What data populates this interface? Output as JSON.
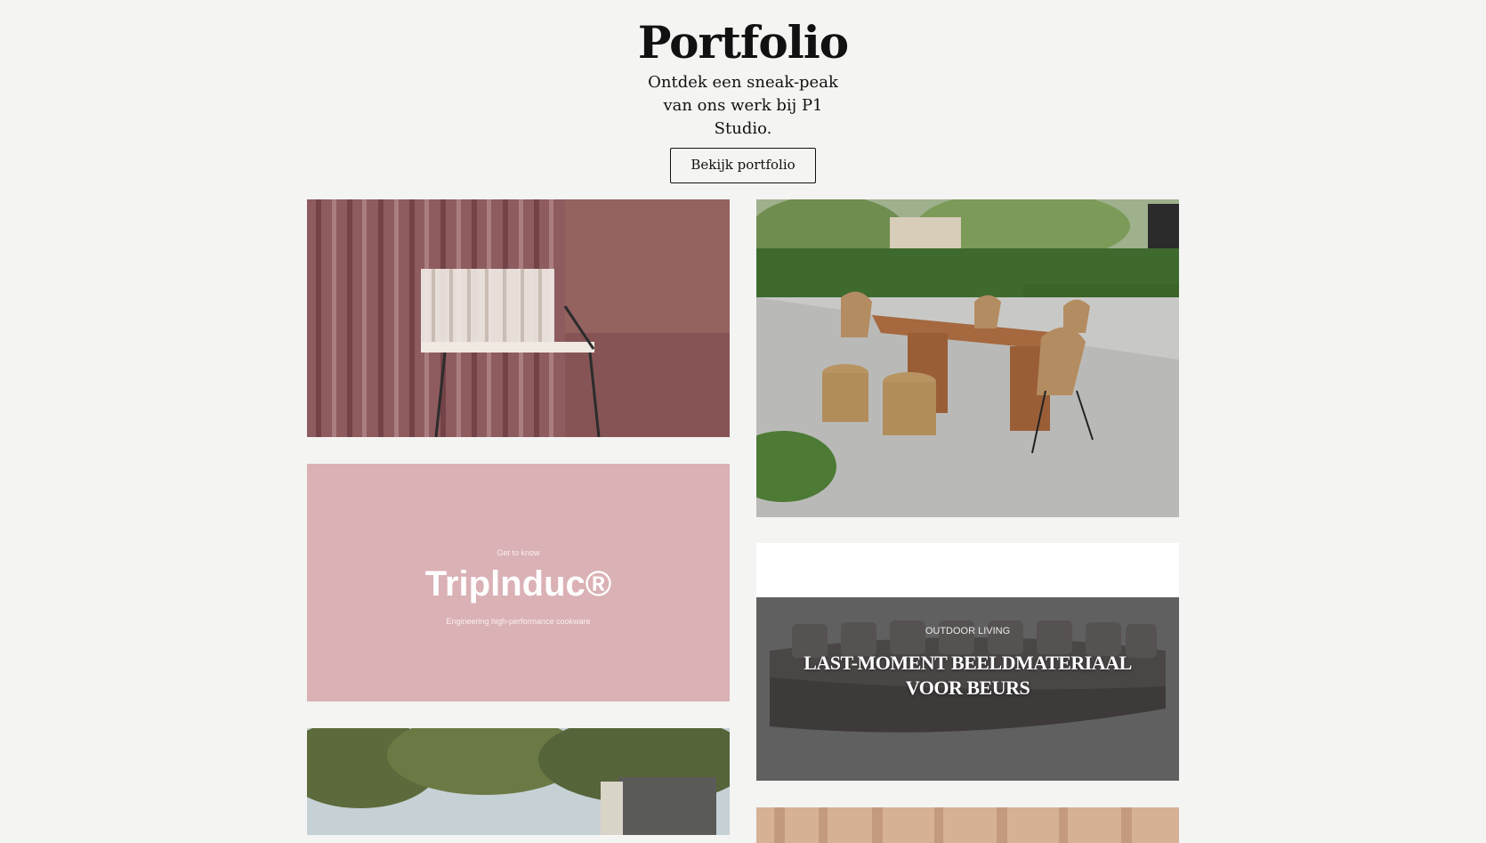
{
  "hero": {
    "title": "Portfolio",
    "subtitle": "Ontdek een sneak-peak van ons werk bij P1 Studio.",
    "cta_label": "Bekijk portfolio"
  },
  "cards": {
    "chair_image": {
      "icon": "fluted-glass-chair-photo"
    },
    "dining_image": {
      "icon": "outdoor-dining-set-photo"
    },
    "triplinduc": {
      "kicker": "Get to know",
      "brand": "Triplnduc®",
      "tagline": "Engineering high-performance cookware"
    },
    "outdoor_living": {
      "category": "OUTDOOR LIVING",
      "title": "LAST-MOMENT BEELDMATERIAAL VOOR BEURS"
    },
    "tree_house_image": {
      "icon": "trees-and-building-photo"
    },
    "curtain_image": {
      "icon": "curtain-photo"
    }
  },
  "colors": {
    "background": "#f4f4f2",
    "text": "#111111",
    "card_pink": "#dab1b5",
    "card_maroon": "#8e5b5e",
    "card_dark": "#5e5e5e"
  }
}
